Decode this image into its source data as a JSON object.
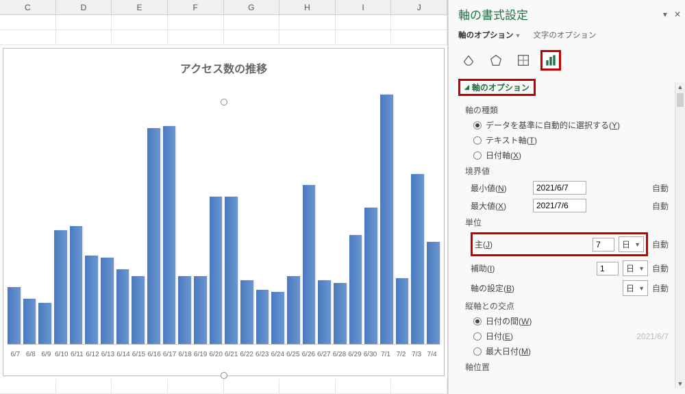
{
  "columns": [
    "C",
    "D",
    "E",
    "F",
    "G",
    "H",
    "I",
    "J"
  ],
  "chart_data": {
    "type": "bar",
    "title": "アクセス数の推移",
    "categories": [
      "6/7",
      "6/8",
      "6/9",
      "6/10",
      "6/11",
      "6/12",
      "6/13",
      "6/14",
      "6/15",
      "6/16",
      "6/17",
      "6/18",
      "6/19",
      "6/20",
      "6/21",
      "6/22",
      "6/23",
      "6/24",
      "6/25",
      "6/26",
      "6/27",
      "6/28",
      "6/29",
      "6/30",
      "7/1",
      "7/2",
      "7/3",
      "7/4"
    ],
    "values": [
      25,
      20,
      18,
      50,
      52,
      39,
      38,
      33,
      30,
      95,
      96,
      30,
      30,
      65,
      65,
      28,
      24,
      23,
      30,
      70,
      28,
      27,
      48,
      60,
      110,
      29,
      75,
      45
    ],
    "ylim": [
      0,
      115
    ]
  },
  "pane": {
    "title": "軸の書式設定",
    "tabs": {
      "axis": "軸のオプション",
      "text": "文字のオプション"
    },
    "section": "軸のオプション",
    "axis_type_label": "軸の種類",
    "axis_type": {
      "auto": "データを基準に自動的に選択する(Y)",
      "text": "テキスト軸(T)",
      "date": "日付軸(X)"
    },
    "bounds_label": "境界値",
    "min_label": "最小値(N)",
    "min_value": "2021/6/7",
    "max_label": "最大値(X)",
    "max_value": "2021/7/6",
    "auto_text": "自動",
    "unit_label": "単位",
    "major_label": "主(J)",
    "major_value": "7",
    "major_unit": "日",
    "minor_label": "補助(I)",
    "minor_value": "1",
    "minor_unit": "日",
    "axis_set_label": "軸の設定(B)",
    "axis_set_unit": "日",
    "cross_label": "縦軸との交点",
    "cross": {
      "between": "日付の間(W)",
      "at_date": "日付(E)",
      "at_date_value": "2021/6/7",
      "max_date": "最大日付(M)"
    },
    "axis_pos_label": "軸位置"
  }
}
